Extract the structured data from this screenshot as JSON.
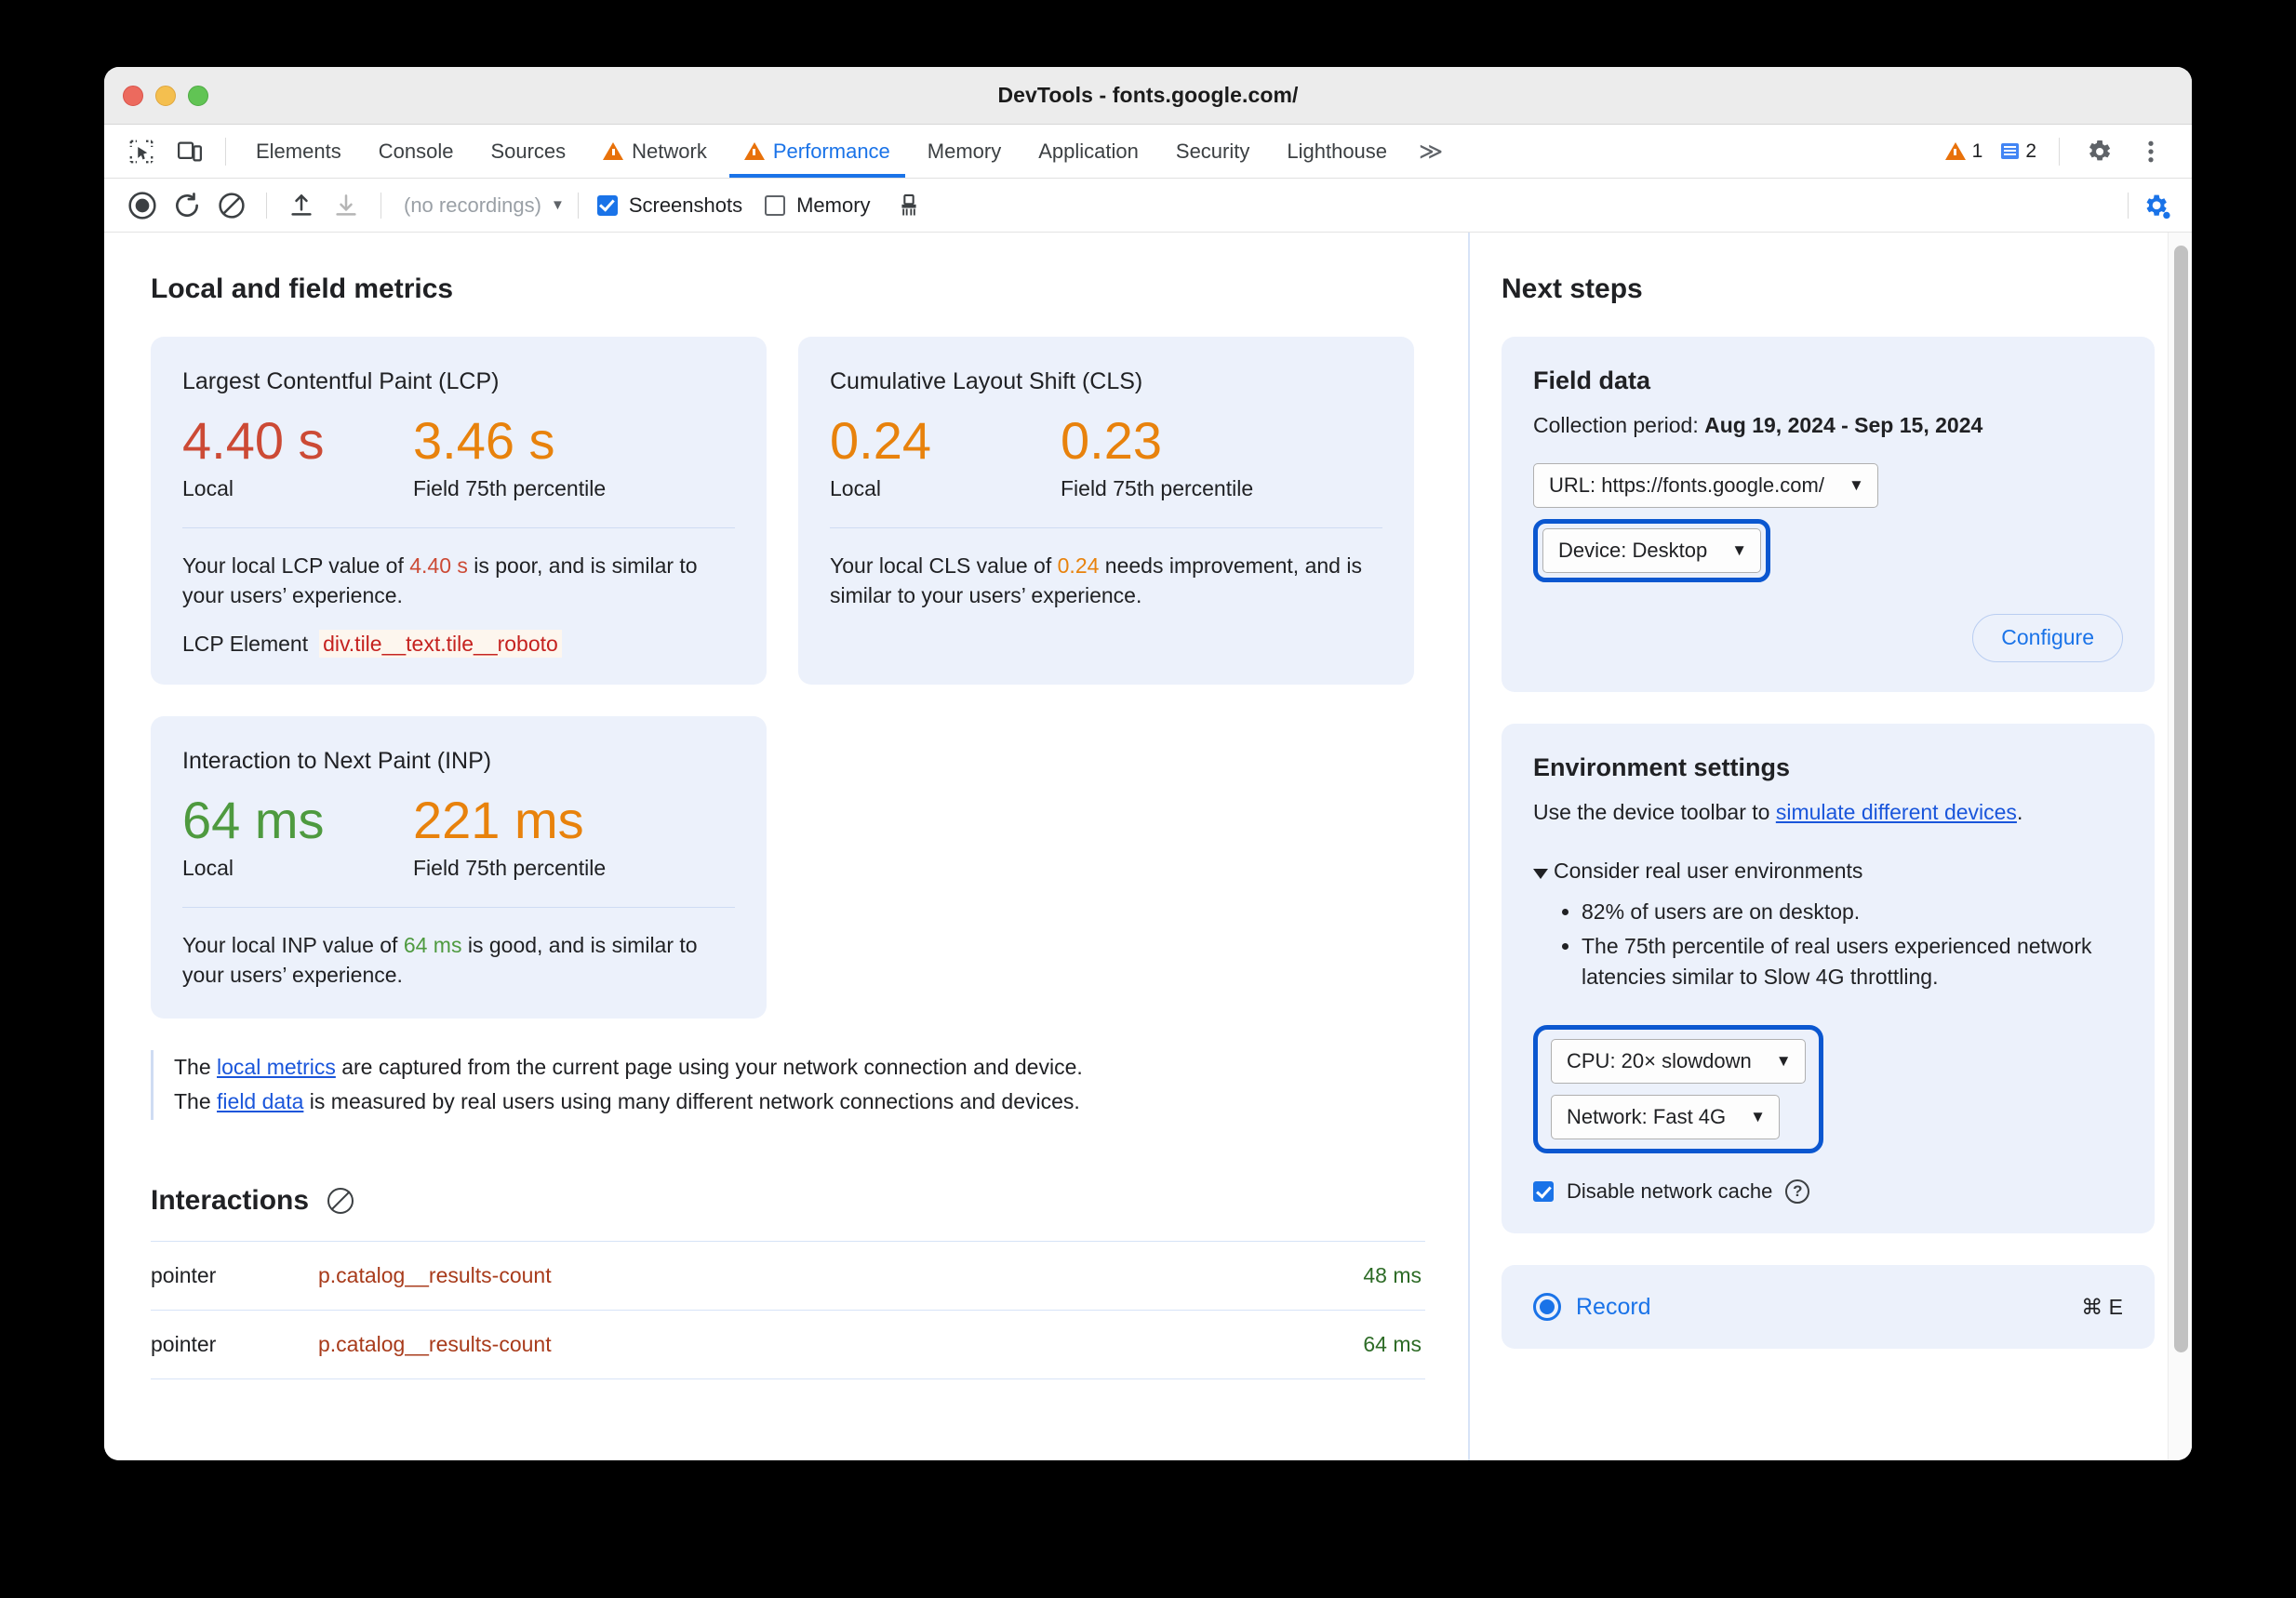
{
  "window": {
    "title": "DevTools - fonts.google.com/",
    "traffic_lights": [
      "close",
      "minimize",
      "zoom"
    ]
  },
  "tabs": {
    "items": [
      {
        "label": "Elements",
        "warning": false,
        "active": false
      },
      {
        "label": "Console",
        "warning": false,
        "active": false
      },
      {
        "label": "Sources",
        "warning": false,
        "active": false
      },
      {
        "label": "Network",
        "warning": true,
        "active": false
      },
      {
        "label": "Performance",
        "warning": true,
        "active": true
      },
      {
        "label": "Memory",
        "warning": false,
        "active": false
      },
      {
        "label": "Application",
        "warning": false,
        "active": false
      },
      {
        "label": "Security",
        "warning": false,
        "active": false
      },
      {
        "label": "Lighthouse",
        "warning": false,
        "active": false
      }
    ],
    "more_label": "≫",
    "warning_count": "1",
    "message_count": "2"
  },
  "toolbar": {
    "recordings_label": "(no recordings)",
    "screenshots_label": "Screenshots",
    "screenshots_checked": true,
    "memory_label": "Memory",
    "memory_checked": false
  },
  "left": {
    "heading": "Local and field metrics",
    "metrics": [
      {
        "title": "Largest Contentful Paint (LCP)",
        "local_value": "4.40 s",
        "local_caption": "Local",
        "local_color": "poor",
        "field_value": "3.46 s",
        "field_caption": "Field 75th percentile",
        "field_color": "ni",
        "desc_pre": "Your local LCP value of ",
        "desc_highlight": "4.40 s",
        "desc_post": " is poor, and is similar to your users’ experience.",
        "element_label": "LCP Element",
        "element_value": "div.tile__text.tile__roboto"
      },
      {
        "title": "Cumulative Layout Shift (CLS)",
        "local_value": "0.24",
        "local_caption": "Local",
        "local_color": "ni",
        "field_value": "0.23",
        "field_caption": "Field 75th percentile",
        "field_color": "ni",
        "desc_pre": "Your local CLS value of ",
        "desc_highlight": "0.24",
        "desc_post": " needs improvement, and is similar to your users’ experience."
      },
      {
        "title": "Interaction to Next Paint (INP)",
        "local_value": "64 ms",
        "local_caption": "Local",
        "local_color": "good",
        "field_value": "221 ms",
        "field_caption": "Field 75th percentile",
        "field_color": "ni",
        "desc_pre": "Your local INP value of ",
        "desc_highlight": "64 ms",
        "desc_post": " is good, and is similar to your users’ experience."
      }
    ],
    "note": {
      "line1_pre": "The ",
      "line1_link": "local metrics",
      "line1_post": " are captured from the current page using your network connection and device.",
      "line2_pre": "The ",
      "line2_link": "field data",
      "line2_post": " is measured by real users using many different network connections and devices."
    },
    "interactions": {
      "title": "Interactions",
      "clear_icon": "block-icon",
      "rows": [
        {
          "type": "pointer",
          "selector": "p.catalog__results-count",
          "duration": "48 ms"
        },
        {
          "type": "pointer",
          "selector": "p.catalog__results-count",
          "duration": "64 ms"
        }
      ]
    }
  },
  "right": {
    "heading": "Next steps",
    "field_data": {
      "title": "Field data",
      "collection_label": "Collection period: ",
      "collection_value": "Aug 19, 2024 - Sep 15, 2024",
      "url_select": "URL: https://fonts.google.com/",
      "device_select": "Device: Desktop",
      "device_focused": true,
      "configure_label": "Configure"
    },
    "environment": {
      "title": "Environment settings",
      "desc_pre": "Use the device toolbar to ",
      "desc_link": "simulate different devices",
      "desc_post": ".",
      "disclosure_label": "Consider real user environments",
      "bullets": [
        "82% of users are on desktop.",
        "The 75th percentile of real users experienced network latencies similar to Slow 4G throttling."
      ],
      "cpu_select": "CPU: 20× slowdown",
      "network_select": "Network: Fast 4G",
      "throttle_focused": true,
      "cache_label": "Disable network cache",
      "cache_checked": true,
      "help_icon": "?"
    },
    "record": {
      "label": "Record",
      "shortcut": "⌘ E"
    }
  },
  "colors": {
    "poor": "#cc4a35",
    "needs_improvement": "#e8820c",
    "good": "#4e9a3f",
    "accent_blue": "#1a73e8",
    "focus_ring": "#0b57d0",
    "card_bg": "#ecf1fb"
  }
}
